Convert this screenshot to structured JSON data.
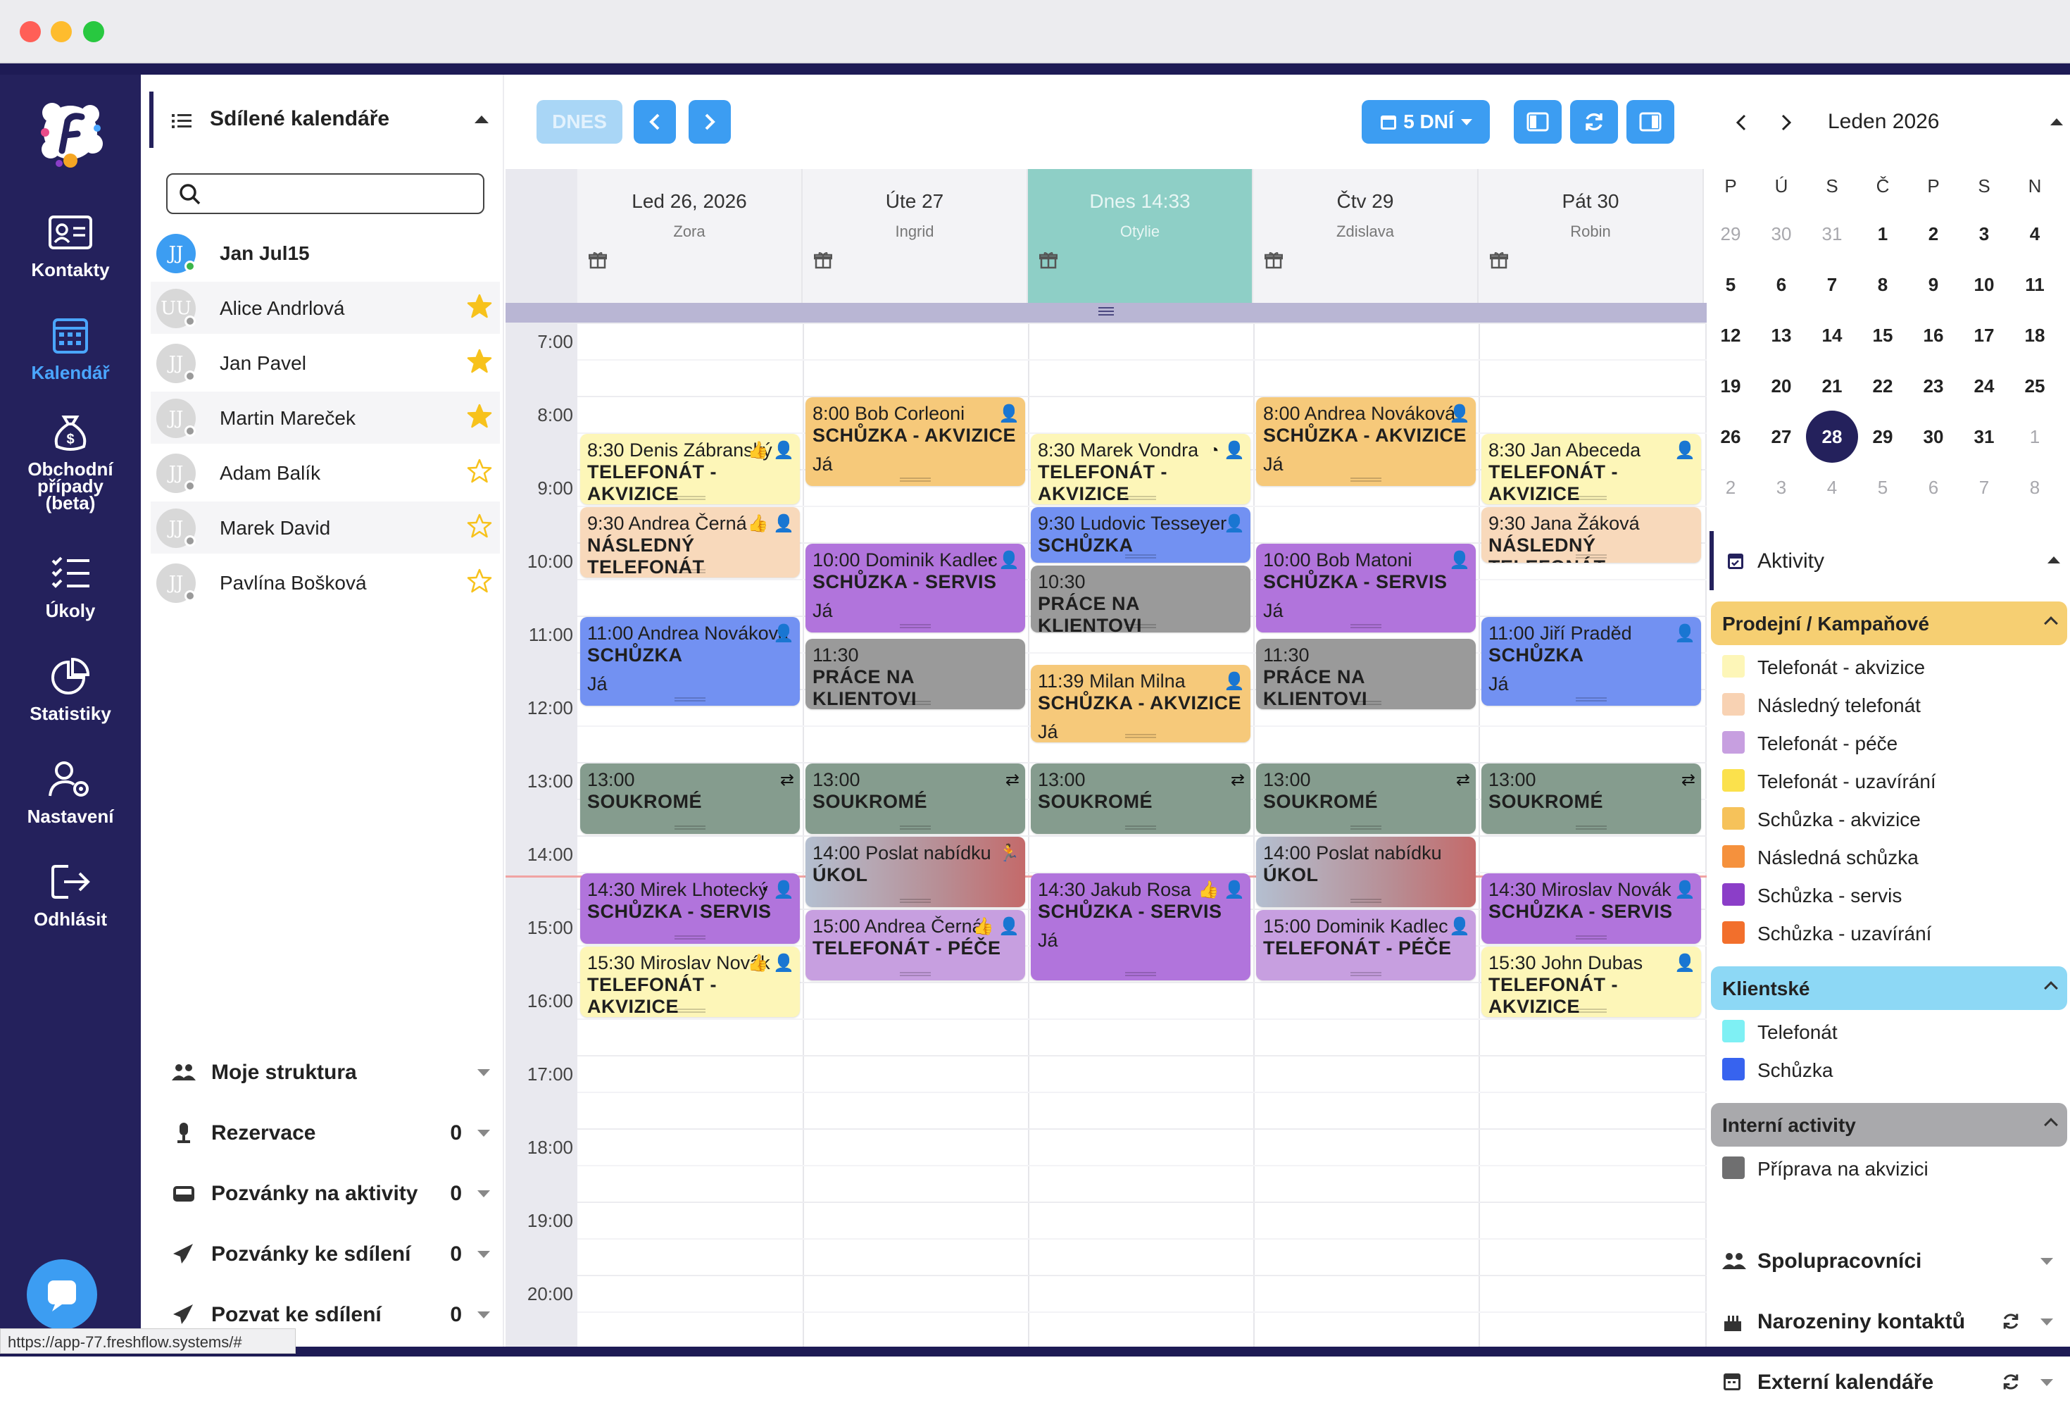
{
  "url_status": "https://app-77.freshflow.systems/#",
  "nav": [
    {
      "id": "kontakty",
      "label": "Kontakty",
      "icon": "contact-card-icon"
    },
    {
      "id": "kalendar",
      "label": "Kalendář",
      "icon": "calendar-icon",
      "active": true
    },
    {
      "id": "obchodni",
      "label": "Obchodní případy (beta)",
      "icon": "money-bag-icon"
    },
    {
      "id": "ukoly",
      "label": "Úkoly",
      "icon": "checklist-icon"
    },
    {
      "id": "statistiky",
      "label": "Statistiky",
      "icon": "pie-chart-icon"
    },
    {
      "id": "nastaveni",
      "label": "Nastavení",
      "icon": "user-gear-icon"
    },
    {
      "id": "odhlasit",
      "label": "Odhlásit",
      "icon": "logout-icon"
    }
  ],
  "sidebar": {
    "title": "Sdílené kalendáře",
    "search_placeholder": "",
    "users": [
      {
        "initials": "JJ",
        "name": "Jan Jul15",
        "bold": true,
        "star": "none",
        "online": true
      },
      {
        "initials": "UU",
        "name": "Alice Andrlová",
        "star": "filled"
      },
      {
        "initials": "JJ",
        "name": "Jan Pavel",
        "star": "filled"
      },
      {
        "initials": "JJ",
        "name": "Martin Mareček",
        "star": "filled"
      },
      {
        "initials": "JJ",
        "name": "Adam Balík",
        "star": "outline"
      },
      {
        "initials": "JJ",
        "name": "Marek David",
        "star": "outline"
      },
      {
        "initials": "JJ",
        "name": "Pavlína Bošková",
        "star": "outline"
      }
    ],
    "sections": [
      {
        "label": "Moje struktura",
        "count": ""
      },
      {
        "label": "Rezervace",
        "count": "0"
      },
      {
        "label": "Pozvánky na aktivity",
        "count": "0"
      },
      {
        "label": "Pozvánky ke sdílení",
        "count": "0"
      },
      {
        "label": "Pozvat ke sdílení",
        "count": "0"
      }
    ]
  },
  "toolbar": {
    "today": "DNES",
    "view": "5 DNÍ"
  },
  "calendar": {
    "days": [
      {
        "label": "Led 26, 2026",
        "name": "Zora"
      },
      {
        "label": "Úte 27",
        "name": "Ingrid"
      },
      {
        "label": "Dnes 14:33",
        "name": "Otylie",
        "today": true
      },
      {
        "label": "Čtv 29",
        "name": "Zdislava"
      },
      {
        "label": "Pát 30",
        "name": "Robin"
      }
    ],
    "hours": [
      "7:00",
      "8:00",
      "9:00",
      "10:00",
      "11:00",
      "12:00",
      "13:00",
      "14:00",
      "15:00",
      "16:00",
      "17:00",
      "18:00",
      "19:00",
      "20:00"
    ],
    "events": [
      {
        "day": 0,
        "start": 8.5,
        "end": 9.5,
        "time": "8:30 Denis Zábranský",
        "kind": "TELEFONÁT - AKVIZICE",
        "color": "#fdf6b8",
        "icons": "👍 👤"
      },
      {
        "day": 0,
        "start": 9.5,
        "end": 10.5,
        "time": "9:30 Andrea Černá",
        "kind": "NÁSLEDNÝ TELEFONÁT",
        "color": "#f8d9bb",
        "icons": "👍 👤"
      },
      {
        "day": 0,
        "start": 11,
        "end": 12.25,
        "time": "11:00 Andrea Nováková",
        "kind": "SCHŮZKA",
        "owner": "Já",
        "color": "#7291f2",
        "icons": "👤"
      },
      {
        "day": 0,
        "start": 13,
        "end": 14,
        "time": "13:00",
        "kind": "SOUKROMÉ",
        "color": "#859c8e",
        "icons": "⇄"
      },
      {
        "day": 0,
        "start": 14.5,
        "end": 15.5,
        "time": "14:30 Mirek Lhotecký",
        "kind": "SCHŮZKA - SERVIS",
        "color": "#b174dc",
        "icons": "◔ 👤"
      },
      {
        "day": 0,
        "start": 15.5,
        "end": 16.5,
        "time": "15:30 Miroslav Novák",
        "kind": "TELEFONÁT - AKVIZICE",
        "color": "#fdf6b8",
        "icons": "👍 👤"
      },
      {
        "day": 1,
        "start": 8,
        "end": 9.25,
        "time": "8:00 Bob Corleoni",
        "kind": "SCHŮZKA - AKVIZICE",
        "owner": "Já",
        "color": "#f6c97a",
        "icons": "👤"
      },
      {
        "day": 1,
        "start": 10,
        "end": 11.25,
        "time": "10:00 Dominik Kadlec",
        "kind": "SCHŮZKA - SERVIS",
        "owner": "Já",
        "color": "#b174dc",
        "icons": "◔ 👤"
      },
      {
        "day": 1,
        "start": 11.3,
        "end": 12.3,
        "time": "11:30",
        "kind": "PRÁCE NA KLIENTOVI",
        "color": "#9a9a9a",
        "icons": ""
      },
      {
        "day": 1,
        "start": 13,
        "end": 14,
        "time": "13:00",
        "kind": "SOUKROMÉ",
        "color": "#859c8e",
        "icons": "⇄"
      },
      {
        "day": 1,
        "start": 14,
        "end": 15,
        "time": "14:00 Poslat nabídku",
        "kind": "ÚKOL",
        "color": "linear-gradient(90deg,#b4bfd0,#b78f96 60%,#c46a6a)",
        "icons": "🏃"
      },
      {
        "day": 1,
        "start": 15,
        "end": 16,
        "time": "15:00 Andrea Černá",
        "kind": "TELEFONÁT - PÉČE",
        "color": "#c79fe0",
        "icons": "👍 👤"
      },
      {
        "day": 2,
        "start": 8.5,
        "end": 9.5,
        "time": "8:30 Marek Vondra",
        "kind": "TELEFONÁT - AKVIZICE",
        "color": "#fdf6b8",
        "icons": "◔ 👤"
      },
      {
        "day": 2,
        "start": 9.5,
        "end": 10.3,
        "time": "9:30 Ludovic Tesseyer",
        "kind": "SCHŮZKA",
        "color": "#7291f2",
        "icons": "👤"
      },
      {
        "day": 2,
        "start": 10.3,
        "end": 11.25,
        "time": "10:30",
        "kind": "PRÁCE NA KLIENTOVI",
        "color": "#9a9a9a",
        "icons": ""
      },
      {
        "day": 2,
        "start": 11.65,
        "end": 12.75,
        "time": "11:39 Milan Milna",
        "kind": "SCHŮZKA - AKVIZICE",
        "owner": "Já",
        "color": "#f6c97a",
        "icons": "👤"
      },
      {
        "day": 2,
        "start": 13,
        "end": 14,
        "time": "13:00",
        "kind": "SOUKROMÉ",
        "color": "#859c8e",
        "icons": "⇄"
      },
      {
        "day": 2,
        "start": 14.5,
        "end": 16,
        "time": "14:30 Jakub Rosa",
        "kind": "SCHŮZKA - SERVIS",
        "owner": "Já",
        "color": "#b174dc",
        "icons": "👍 👤"
      },
      {
        "day": 3,
        "start": 8,
        "end": 9.25,
        "time": "8:00 Andrea Nováková",
        "kind": "SCHŮZKA - AKVIZICE",
        "owner": "Já",
        "color": "#f6c97a",
        "icons": "👤"
      },
      {
        "day": 3,
        "start": 10,
        "end": 11.25,
        "time": "10:00 Bob Matoni",
        "kind": "SCHŮZKA - SERVIS",
        "owner": "Já",
        "color": "#b174dc",
        "icons": "👤"
      },
      {
        "day": 3,
        "start": 11.3,
        "end": 12.3,
        "time": "11:30",
        "kind": "PRÁCE NA KLIENTOVI",
        "color": "#9a9a9a",
        "icons": ""
      },
      {
        "day": 3,
        "start": 13,
        "end": 14,
        "time": "13:00",
        "kind": "SOUKROMÉ",
        "color": "#859c8e",
        "icons": "⇄"
      },
      {
        "day": 3,
        "start": 14,
        "end": 15,
        "time": "14:00 Poslat nabídku",
        "kind": "ÚKOL",
        "color": "linear-gradient(90deg,#b4bfd0,#b78f96 60%,#c46a6a)",
        "icons": ""
      },
      {
        "day": 3,
        "start": 15,
        "end": 16,
        "time": "15:00 Dominik Kadlec",
        "kind": "TELEFONÁT - PÉČE",
        "color": "#c79fe0",
        "icons": "👤"
      },
      {
        "day": 4,
        "start": 8.5,
        "end": 9.5,
        "time": "8:30 Jan Abeceda",
        "kind": "TELEFONÁT - AKVIZICE",
        "color": "#fdf6b8",
        "icons": "👤"
      },
      {
        "day": 4,
        "start": 9.5,
        "end": 10.3,
        "time": "9:30 Jana Žáková",
        "kind": "NÁSLEDNÝ TELEFONÁT",
        "color": "#f8d9bb",
        "icons": ""
      },
      {
        "day": 4,
        "start": 11,
        "end": 12.25,
        "time": "11:00 Jiří Praděd",
        "kind": "SCHŮZKA",
        "owner": "Já",
        "color": "#7291f2",
        "icons": "👤"
      },
      {
        "day": 4,
        "start": 13,
        "end": 14,
        "time": "13:00",
        "kind": "SOUKROMÉ",
        "color": "#859c8e",
        "icons": "⇄"
      },
      {
        "day": 4,
        "start": 14.5,
        "end": 15.5,
        "time": "14:30 Miroslav Novák",
        "kind": "SCHŮZKA - SERVIS",
        "color": "#b174dc",
        "icons": "👤"
      },
      {
        "day": 4,
        "start": 15.5,
        "end": 16.5,
        "time": "15:30 John Dubas",
        "kind": "TELEFONÁT - AKVIZICE",
        "color": "#fdf6b8",
        "icons": "👤"
      }
    ]
  },
  "mini_calendar": {
    "title": "Leden 2026",
    "weekdays": [
      "P",
      "Ú",
      "S",
      "Č",
      "P",
      "S",
      "N"
    ],
    "weeks": [
      [
        {
          "d": "29",
          "m": true
        },
        {
          "d": "30",
          "m": true
        },
        {
          "d": "31",
          "m": true
        },
        {
          "d": "1"
        },
        {
          "d": "2"
        },
        {
          "d": "3"
        },
        {
          "d": "4"
        }
      ],
      [
        {
          "d": "5"
        },
        {
          "d": "6"
        },
        {
          "d": "7"
        },
        {
          "d": "8"
        },
        {
          "d": "9"
        },
        {
          "d": "10"
        },
        {
          "d": "11"
        }
      ],
      [
        {
          "d": "12"
        },
        {
          "d": "13"
        },
        {
          "d": "14"
        },
        {
          "d": "15"
        },
        {
          "d": "16"
        },
        {
          "d": "17"
        },
        {
          "d": "18"
        }
      ],
      [
        {
          "d": "19"
        },
        {
          "d": "20"
        },
        {
          "d": "21"
        },
        {
          "d": "22"
        },
        {
          "d": "23"
        },
        {
          "d": "24"
        },
        {
          "d": "25"
        }
      ],
      [
        {
          "d": "26"
        },
        {
          "d": "27"
        },
        {
          "d": "28",
          "sel": true
        },
        {
          "d": "29"
        },
        {
          "d": "30"
        },
        {
          "d": "31"
        },
        {
          "d": "1",
          "m": true
        }
      ],
      [
        {
          "d": "2",
          "m": true
        },
        {
          "d": "3",
          "m": true
        },
        {
          "d": "4",
          "m": true
        },
        {
          "d": "5",
          "m": true
        },
        {
          "d": "6",
          "m": true
        },
        {
          "d": "7",
          "m": true
        },
        {
          "d": "8",
          "m": true
        }
      ]
    ]
  },
  "activities": {
    "title": "Aktivity",
    "groups": [
      {
        "label": "Prodejní / Kampaňové",
        "color": "#f6cf72",
        "items": [
          {
            "label": "Telefonát - akvizice",
            "color": "#fdf6b8"
          },
          {
            "label": "Následný telefonát",
            "color": "#f8d2b3"
          },
          {
            "label": "Telefonát - péče",
            "color": "#c79fe0"
          },
          {
            "label": "Telefonát - uzavírání",
            "color": "#fbe14c"
          },
          {
            "label": "Schůzka - akvizice",
            "color": "#f6c25a"
          },
          {
            "label": "Následná schůzka",
            "color": "#f5913d"
          },
          {
            "label": "Schůzka - servis",
            "color": "#8b3ec8"
          },
          {
            "label": "Schůzka - uzavírání",
            "color": "#f26f2c"
          }
        ]
      },
      {
        "label": "Klientské",
        "color": "#8dd8f5",
        "items": [
          {
            "label": "Telefonát",
            "color": "#7ef0f4"
          },
          {
            "label": "Schůzka",
            "color": "#3763ef"
          }
        ]
      },
      {
        "label": "Interní activity",
        "color": "#a9a9ac",
        "items": [
          {
            "label": "Příprava na akvizici",
            "color": "#6f6f70"
          }
        ]
      }
    ],
    "sections": [
      {
        "label": "Spolupracovníci"
      },
      {
        "label": "Narozeniny kontaktů"
      },
      {
        "label": "Externí kalendáře"
      }
    ]
  }
}
